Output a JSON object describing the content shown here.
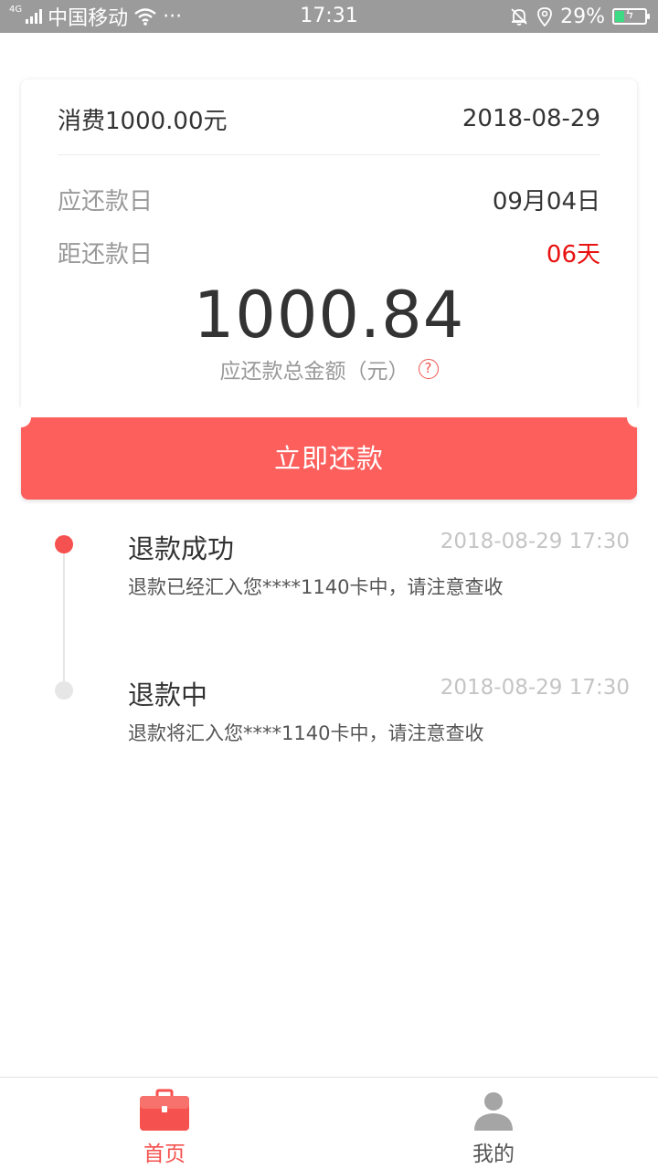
{
  "status_bar": {
    "network": "4G",
    "carrier": "中国移动",
    "more": "···",
    "time": "17:31",
    "battery": "29%"
  },
  "card": {
    "title": "消费1000.00元",
    "date": "2018-08-29",
    "due_label": "应还款日",
    "due_value": "09月04日",
    "remaining_label": "距还款日",
    "remaining_value": "06天",
    "amount": "1000.84",
    "amount_label": "应还款总金额（元）",
    "help": "?"
  },
  "pay_button": {
    "label": "立即还款"
  },
  "timeline": [
    {
      "title": "退款成功",
      "time": "2018-08-29 17:30",
      "desc": "退款已经汇入您****1140卡中，请注意查收"
    },
    {
      "title": "退款中",
      "time": "2018-08-29 17:30",
      "desc": "退款将汇入您****1140卡中，请注意查收"
    }
  ],
  "tabs": {
    "home": {
      "label": "首页",
      "icon": "briefcase-icon"
    },
    "me": {
      "label": "我的",
      "icon": "user-icon"
    }
  },
  "colors": {
    "accent": "#fd5f5c",
    "highlight_red": "#e8110f",
    "status_bar": "#9b9b9b"
  }
}
